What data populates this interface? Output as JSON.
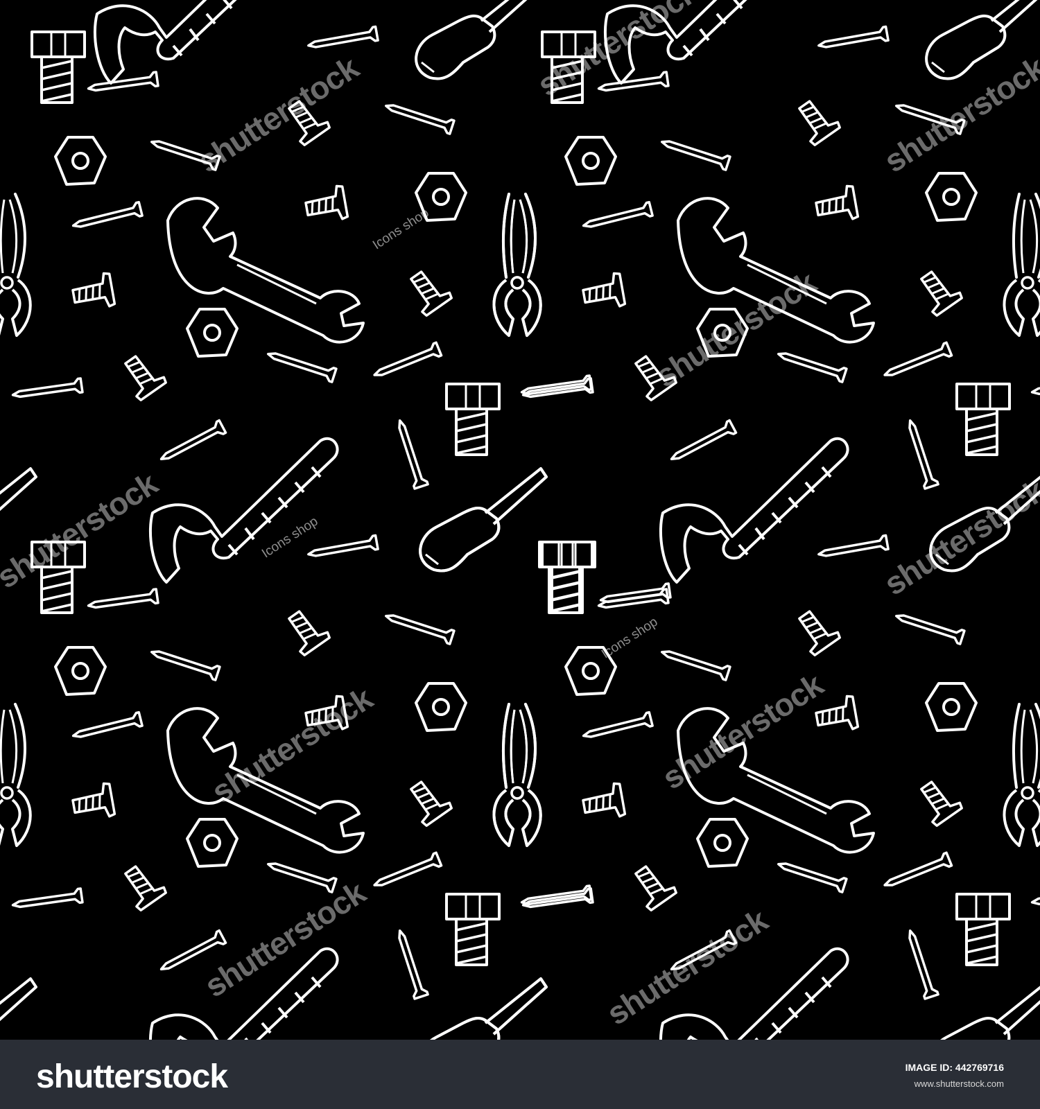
{
  "colors": {
    "background": "#000000",
    "doodle": "#ffffff",
    "footer": "#2a2e36",
    "watermark": "#9a9a9a"
  },
  "icons": [
    "hammer-icon",
    "wrench-icon",
    "pliers-icon",
    "screwdriver-icon",
    "bolt-icon",
    "nut-icon",
    "screw-icon",
    "nail-icon"
  ],
  "watermark": {
    "stock_text": "shutterstock",
    "shop_text": "Icons shop"
  },
  "footer": {
    "logo_text": "shutterstock",
    "image_id_label": "IMAGE ID:",
    "image_id_value": "442769716",
    "url": "www.shutterstock.com"
  }
}
